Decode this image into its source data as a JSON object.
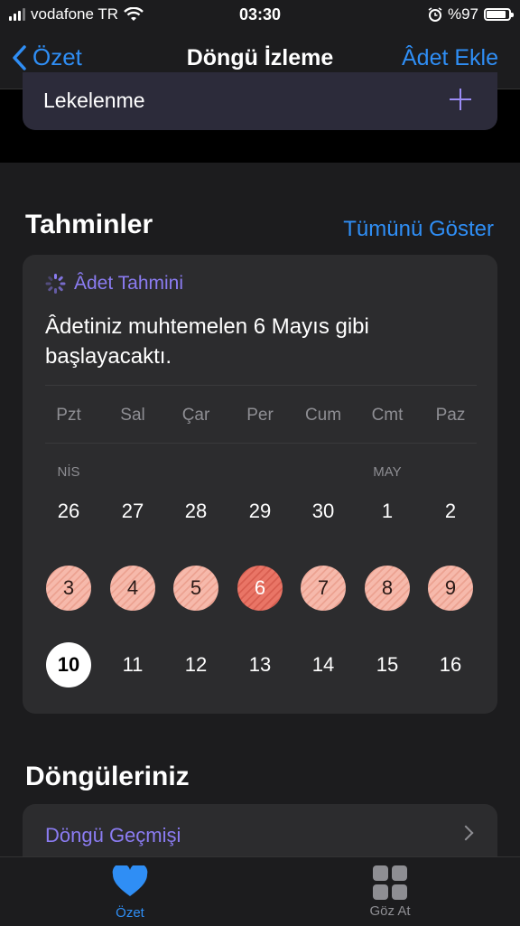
{
  "status_bar": {
    "carrier": "vodafone TR",
    "time": "03:30",
    "battery": "%97",
    "battery_level": 0.97
  },
  "nav": {
    "back_label": "Özet",
    "title": "Döngü İzleme",
    "add_label": "Âdet Ekle"
  },
  "upper_card": {
    "label": "Lekelenme"
  },
  "predictions": {
    "title": "Tahminler",
    "show_all": "Tümünü Göster",
    "card_title": "Âdet Tahmini",
    "message": "Âdetiniz muhtemelen 6 Mayıs gibi başlayacaktı.",
    "weekdays": [
      "Pzt",
      "Sal",
      "Çar",
      "Per",
      "Cum",
      "Cmt",
      "Paz"
    ],
    "month_labels": {
      "april": "NİS",
      "may": "MAY"
    },
    "weeks": [
      [
        "26",
        "27",
        "28",
        "29",
        "30",
        "1",
        "2"
      ],
      [
        "3",
        "4",
        "5",
        "6",
        "7",
        "8",
        "9"
      ],
      [
        "10",
        "11",
        "12",
        "13",
        "14",
        "15",
        "16"
      ]
    ],
    "predicted_days": [
      "3",
      "4",
      "5",
      "6",
      "7",
      "8",
      "9"
    ],
    "predicted_start": "6",
    "today": "10"
  },
  "cycles": {
    "title": "Döngüleriniz",
    "history_label": "Döngü Geçmişi"
  },
  "tabs": [
    {
      "label": "Özet",
      "icon": "heart-icon",
      "active": true
    },
    {
      "label": "Göz At",
      "icon": "grid-icon",
      "active": false
    }
  ],
  "colors": {
    "accent_blue": "#2f8ef5",
    "accent_purple": "#8b7cf2",
    "period": "#e97566",
    "period_light": "#f6b9ab"
  }
}
